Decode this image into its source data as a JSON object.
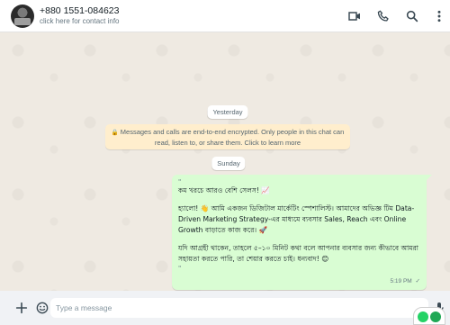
{
  "header": {
    "contact_name": "+880 1551-084623",
    "contact_sub": "click here for contact info",
    "icons": [
      "video-call-icon",
      "voice-call-icon",
      "search-icon",
      "menu-icon"
    ]
  },
  "chat": {
    "date_yesterday": "Yesterday",
    "encryption_notice_line1": "Messages and calls are end-to-end encrypted. Only people in this chat can",
    "encryption_notice_line2": "read, listen to, or share them. Click to learn more",
    "date_sunday": "Sunday",
    "message": {
      "dot_top": "\"",
      "line1": "কম খরচে আরও বেশি সেলস! 📈",
      "line2": "হ্যালো! 👋 আমি একজন ডিজিটাল মার্কেটিং স্পেশালিস্ট। আমাদের অভিজ্ঞ টিম Data-Driven Marketing Strategy-এর মাধ্যমে ব্যবসার Sales, Reach এবং Online Growth বাড়াতে কাজ করে। 🚀",
      "line3": "যদি আগ্রহী থাকেন, তাহলে ৫–১০ মিনিট কথা বলে আপনার ব্যবসার জন্য কীভাবে আমরা সহায়তা করতে পারি, তা শেয়ার করতে চাই। ধন্যবাদ! 😊",
      "dot_bottom": "\"",
      "time": "5:19 PM",
      "ticks": "✓"
    }
  },
  "footer": {
    "input_placeholder": "Type a message"
  },
  "colors": {
    "header_bg": "#ffffff",
    "chat_bg": "#efeae2",
    "outgoing_bubble": "#d9fdd3",
    "encryption_bg": "#ffeecd",
    "footer_bg": "#f0f2f5",
    "icon": "#54656f"
  }
}
